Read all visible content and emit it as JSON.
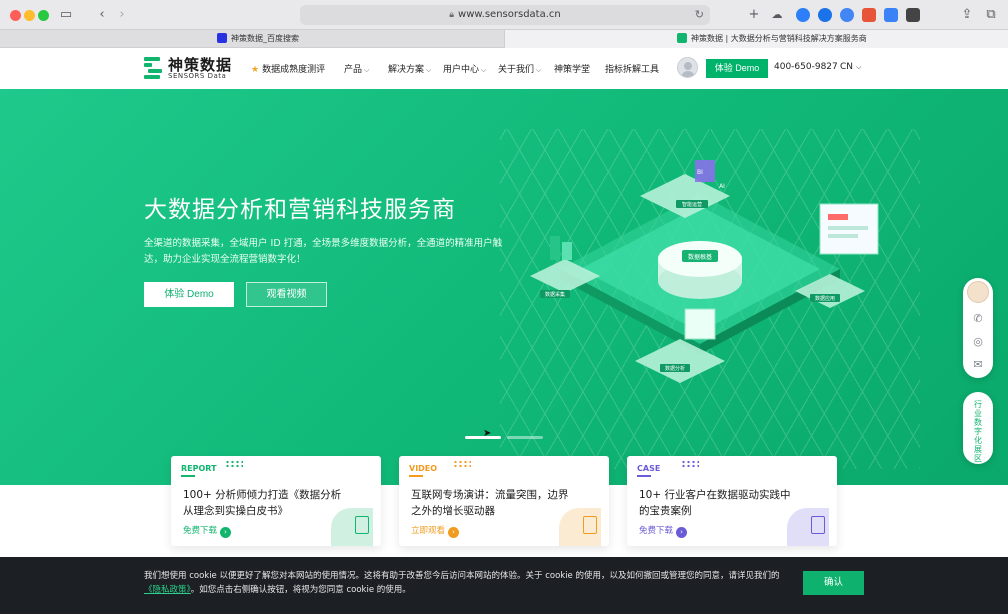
{
  "browser": {
    "url": "www.sensorsdata.cn",
    "tabs": [
      {
        "label": "神策数据_百度搜索"
      },
      {
        "label": "神策数据 | 大数据分析与营销科技解决方案服务商"
      }
    ]
  },
  "header": {
    "logo_cn": "神策数据",
    "logo_en": "SENSORS Data",
    "nav": [
      {
        "label": "数据成熟度测评"
      },
      {
        "label": "产品"
      },
      {
        "label": "解决方案"
      },
      {
        "label": "用户中心"
      },
      {
        "label": "关于我们"
      },
      {
        "label": "神策学堂"
      },
      {
        "label": "指标拆解工具"
      }
    ],
    "demo_label": "体验 Demo",
    "phone": "400-650-9827",
    "lang": "CN"
  },
  "hero": {
    "title": "大数据分析和营销科技服务商",
    "desc": "全渠道的数据采集，全域用户 ID 打通，全场景多维度数据分析，全通道的精准用户触达，助力企业实现全流程营销数字化！",
    "btn_demo": "体验 Demo",
    "btn_video": "观看视频",
    "illus_center": "数据根基",
    "illus_labels": [
      "数据采集",
      "数据分析",
      "数据应用",
      "智能运营",
      "BI",
      "AI"
    ]
  },
  "cards": [
    {
      "tag": "REPORT",
      "title": "100+ 分析师倾力打造《数据分析从理念到实操白皮书》",
      "link": "免费下载"
    },
    {
      "tag": "VIDEO",
      "title": "互联网专场演讲：流量突围，边界之外的增长驱动器",
      "link": "立即观看"
    },
    {
      "tag": "CASE",
      "title": "10+ 行业客户在数据驱动实践中的宝贵案例",
      "link": "免费下载"
    }
  ],
  "side": {
    "vertical": "行业数字化展区"
  },
  "cookie": {
    "text": "我们想使用 cookie 以便更好了解您对本网站的使用情况。这将有助于改善您今后访问本网站的体验。关于 cookie 的使用，以及如何撤回或管理您的同意，请详见我们的",
    "link": "《隐私政策》",
    "text2": "。如您点击右侧确认按钮，将视为您同意 cookie 的使用。",
    "confirm": "确认"
  },
  "colors": {
    "brand": "#00b36b",
    "report": "#12b56e",
    "video": "#f29b21",
    "case": "#6a5bd6"
  }
}
